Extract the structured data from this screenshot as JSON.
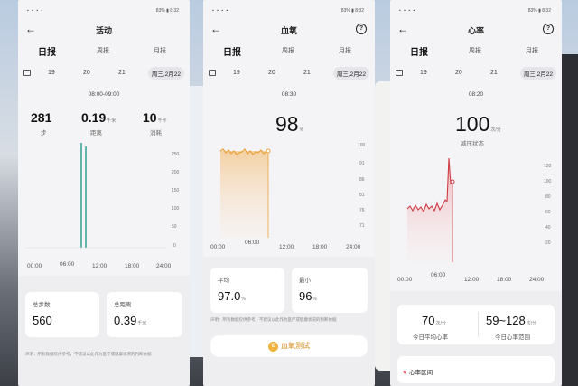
{
  "status": {
    "left": "▪ ▪ ▪ ▪",
    "right": "83% ▮ 8:32"
  },
  "screens": [
    {
      "title": "活动",
      "tabs": [
        "日报",
        "周报",
        "月报"
      ],
      "dates": [
        "19",
        "20",
        "21"
      ],
      "selected_date": "周三,2月22",
      "time_range": "08:00-09:00",
      "metrics": [
        {
          "value": "281",
          "unit": "",
          "label": "步"
        },
        {
          "value": "0.19",
          "unit": "千米",
          "label": "距离"
        },
        {
          "value": "10",
          "unit": "千卡",
          "label": "消耗"
        }
      ],
      "chart_x": [
        "00:00",
        "06:00",
        "12:00",
        "18:00",
        "24:00"
      ],
      "chart_y": [
        "250",
        "200",
        "150",
        "100",
        "50",
        "0"
      ],
      "cards": [
        {
          "title": "总步数",
          "value": "560",
          "unit": ""
        },
        {
          "title": "总距离",
          "value": "0.39",
          "unit": "千米"
        }
      ],
      "note": "声明：所有数据仅供参考，不建议以此作为医疗或健康状况的判断依据"
    },
    {
      "title": "血氧",
      "tabs": [
        "日报",
        "周报",
        "月报"
      ],
      "dates": [
        "19",
        "20",
        "21"
      ],
      "selected_date": "周三,2月22",
      "time_range": "08:30",
      "big_value": "98",
      "big_unit": "%",
      "chart_x": [
        "00:00",
        "06:00",
        "12:00",
        "18:00",
        "24:00"
      ],
      "chart_y": [
        "100",
        "91",
        "86",
        "81",
        "76",
        "71"
      ],
      "cards": [
        {
          "title": "平均",
          "value": "97.0",
          "unit": "%"
        },
        {
          "title": "最小",
          "value": "96",
          "unit": "%"
        }
      ],
      "note": "声明：所有数据仅供参考，不建议以此作为医疗或健康状况的判断依据",
      "button_label": "血氧测试",
      "button_icon": "₤"
    },
    {
      "title": "心率",
      "tabs": [
        "日报",
        "周报",
        "月报"
      ],
      "dates": [
        "19",
        "20",
        "21"
      ],
      "selected_date": "周三,2月22",
      "time_range": "08:20",
      "big_value": "100",
      "big_unit": "次/分",
      "state": "减压状态",
      "chart_x": [
        "00:00",
        "06:00",
        "12:00",
        "18:00",
        "24:00"
      ],
      "chart_y": [
        "120",
        "100",
        "80",
        "60",
        "40",
        "20"
      ],
      "summary": [
        {
          "value": "70",
          "unit": "次/分",
          "label": "今日平均心率"
        },
        {
          "value": "59~128",
          "unit": "次/分",
          "label": "今日心率范围"
        }
      ],
      "section_title": "心率区间",
      "section_icon": "♥"
    }
  ],
  "colors": {
    "steps_bar": "#3fa59a",
    "spo2_line": "#e9a23a",
    "spo2_marker": "#e9a23a",
    "hr_line": "#cf3b44",
    "button_text": "#d38a17"
  }
}
